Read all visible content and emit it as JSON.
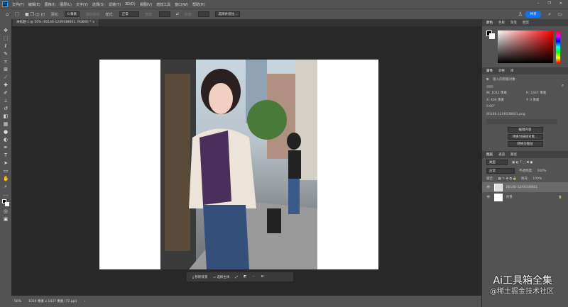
{
  "app": {
    "logo": "Ps"
  },
  "menu": [
    "文件(F)",
    "编辑(E)",
    "图像(I)",
    "图层(L)",
    "文字(Y)",
    "选择(S)",
    "滤镜(T)",
    "3D(D)",
    "视图(V)",
    "增效工具",
    "窗口(W)",
    "帮助(H)"
  ],
  "options": {
    "feather_label": "羽化:",
    "feather_value": "0 像素",
    "antialias": "消除锯齿",
    "style_label": "样式:",
    "style_value": "正常",
    "width_label": "宽度:",
    "height_label": "高度:",
    "select_mask": "选择并遮住...",
    "share": "共享"
  },
  "document_tab": "未标题-1 @ 50% (00146-1249338601, RGB/8) *",
  "context_bar": {
    "remove_bg": "移除背景",
    "select_subject": "选择主体"
  },
  "status": {
    "zoom": "50%",
    "info": "1024 像素 x 1437 像素 (72 ppi)"
  },
  "color_panel": {
    "tabs": [
      "颜色",
      "色板",
      "渐变",
      "图案"
    ]
  },
  "properties": {
    "tabs": [
      "属性",
      "调整",
      "库"
    ],
    "type": "嵌入的智能对象",
    "w": "W: 1012 像素",
    "h": "H: 1437 像素",
    "x": "X: 404 像素",
    "y": "Y: 0 像素",
    "angle": "0.00°",
    "filename": "00146-1249338601.png",
    "buttons": [
      "编辑内容",
      "转换为链接对象...",
      "转换为图层"
    ]
  },
  "layers": {
    "tabs": [
      "图层",
      "通道",
      "路径"
    ],
    "filter": "类型",
    "blend": "正常",
    "opacity_label": "不透明度:",
    "opacity": "100%",
    "lock_label": "锁定:",
    "fill_label": "填充:",
    "fill": "100%",
    "items": [
      {
        "name": "00146-1249338601"
      },
      {
        "name": "背景"
      }
    ]
  },
  "watermark": {
    "title": "Ai工具箱全集",
    "sub": "@稀土掘金技术社区"
  }
}
